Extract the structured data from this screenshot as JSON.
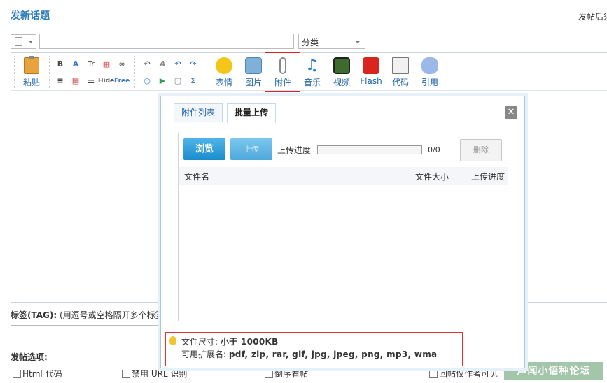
{
  "page": {
    "title": "发新话题",
    "top_right_note": "发帖后须"
  },
  "form": {
    "subject_value": "",
    "category_placeholder": "分类"
  },
  "toolbar": {
    "paste_label": "粘贴",
    "emotion_label": "表情",
    "image_label": "图片",
    "attachment_label": "附件",
    "music_label": "音乐",
    "video_label": "视频",
    "flash_label": "Flash",
    "code_label": "代码",
    "quote_label": "引用",
    "small_buttons_row1": [
      "B",
      "A",
      "Tr",
      "▦",
      "∞",
      "↶",
      "A",
      "↶",
      "↷"
    ],
    "small_buttons_row2": [
      "≡",
      "▤",
      "☰",
      "Hide",
      "Free",
      "◎",
      "▶",
      "▢",
      "Σ"
    ]
  },
  "dialog": {
    "tabs": [
      {
        "label": "附件列表",
        "active": false
      },
      {
        "label": "批量上传",
        "active": true
      }
    ],
    "close_glyph": "✕",
    "browse_label": "浏览",
    "upload_label": "上传",
    "progress_label": "上传进度",
    "progress_value": 0,
    "progress_count": "0/0",
    "delete_label": "删除",
    "columns": {
      "name": "文件名",
      "size": "文件大小",
      "progress": "上传进度"
    },
    "info": {
      "size_prefix": "文件尺寸:",
      "size_value": "小于  1000KB",
      "ext_prefix": "可用扩展名:",
      "ext_value": "pdf, zip, rar, gif, jpg, jpeg, png, mp3, wma"
    }
  },
  "tags": {
    "label_bold": "标签(TAG):",
    "label_hint": " (用逗号或空格隔开多个标签"
  },
  "options": {
    "title": "发帖选项:",
    "items": [
      "Html 代码",
      "禁用 URL 识别",
      "倒序看帖",
      "回帖仅作者可见"
    ]
  },
  "watermark": "声闻小语种论坛",
  "colors": {
    "accent": "#2b7ab8",
    "highlight_border": "#dd2222",
    "button_blue": "#1b8ccc"
  }
}
